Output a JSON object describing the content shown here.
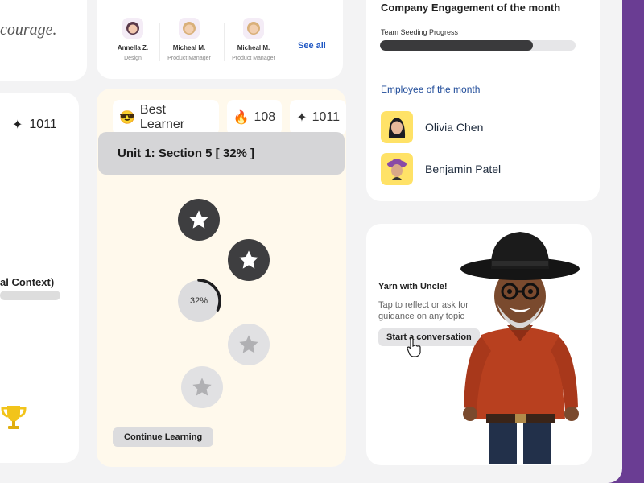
{
  "quote": {
    "fragment": "ct of courage."
  },
  "left_panel": {
    "sparkle_count": "1011",
    "context_label": "al Context)"
  },
  "people": [
    {
      "name": "Annella Z.",
      "role": "Design"
    },
    {
      "name": "Micheal M.",
      "role": "Product Manager"
    },
    {
      "name": "Micheal M.",
      "role": "Product Manager"
    }
  ],
  "see_all_label": "See all",
  "learning": {
    "best_learner_label": "Best Learner",
    "streak_count": "108",
    "sparkle_count": "1011",
    "unit_title": "Unit 1: Section 5  [ 32% ]",
    "progress_label": "32%",
    "progress_fraction": 0.32,
    "continue_label": "Continue Learning"
  },
  "company": {
    "title": "Company Engagement of the month",
    "seeding_label": "Team Seeding Progress",
    "seeding_fraction": 0.78,
    "employee_of_month_label": "Employee of the month",
    "employees": [
      {
        "name": "Olivia Chen"
      },
      {
        "name": "Benjamin Patel"
      }
    ]
  },
  "yarn": {
    "title": "Yarn with Uncle!",
    "subtitle": "Tap to reflect or ask for guidance on any topic",
    "button_label": "Start a conversation"
  },
  "colors": {
    "purple_edge": "#6a3d93",
    "link_blue": "#1f57c3",
    "learning_bg": "#fff9ec",
    "avatar_yellow": "#ffe267"
  }
}
